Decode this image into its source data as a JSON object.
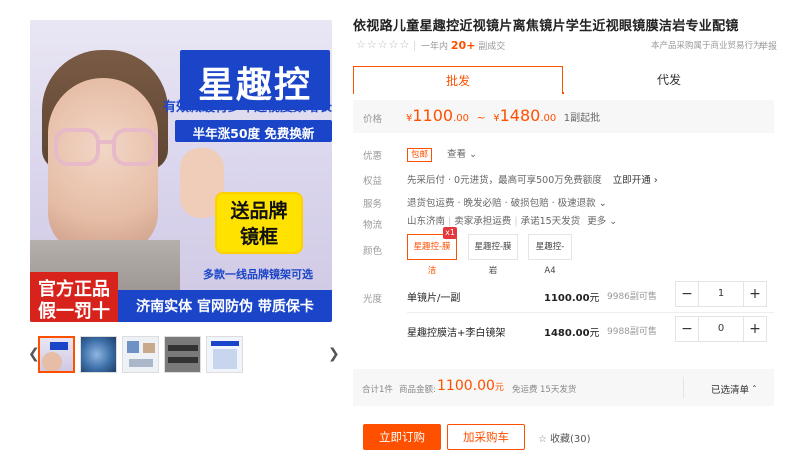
{
  "gallery": {
    "main_image": {
      "title": "星趣控",
      "subtitle1": "有效减缓青少年近视度数增长",
      "subtitle2": "半年涨50度  免费换新",
      "gift_line1": "送品牌",
      "gift_line2": "镜框",
      "multi_brand": "多款一线品牌镜架可选",
      "badge_line1": "官方正品",
      "badge_line2": "假一罚十",
      "bottom_bar": "济南实体  官网防伪  带质保卡"
    },
    "thumbnails": [
      {
        "name": "thumb-1",
        "color": "#d9d4ec",
        "active": true
      },
      {
        "name": "thumb-2",
        "color": "#5a8fc7",
        "active": false
      },
      {
        "name": "thumb-3",
        "color": "#cfd8e3",
        "active": false
      },
      {
        "name": "thumb-4",
        "color": "#6c6c6c",
        "active": false
      },
      {
        "name": "thumb-5",
        "color": "#dfe7f4",
        "active": false
      }
    ],
    "prev_icon": "chevron-left-icon",
    "next_icon": "chevron-right-icon"
  },
  "product": {
    "title": "依视路儿童星趣控近视镜片离焦镜片学生近视眼镜膜洁岩专业配镜",
    "rating_stars": "☆☆☆☆☆",
    "sold_prefix": "一年内",
    "sold_count": "20+",
    "sold_suffix": "副成交",
    "notice": "本产品采购属于商业贸易行为",
    "report": "举报"
  },
  "tabs": {
    "wholesale": "批发",
    "dropship": "代发"
  },
  "price": {
    "label": "价格",
    "currency": "¥",
    "low_int": "1100",
    "low_dec": ".00",
    "tilde": "~",
    "high_int": "1480",
    "high_dec": ".00",
    "moq": "1副起批"
  },
  "offers": {
    "label": "优惠",
    "tag": "包邮",
    "view": "查看",
    "view_icon": "chevron-down-icon"
  },
  "rights": {
    "label": "权益",
    "text": "先采后付 · 0元进货，最高可享500万免费额度",
    "link": "立即开通",
    "link_icon": "chevron-right-icon"
  },
  "service": {
    "label": "服务",
    "text": "退货包运费 · 晚发必赔 · 破损包赔 · 极速退款",
    "icon": "chevron-down-icon"
  },
  "logistics": {
    "label": "物流",
    "location": "山东济南",
    "carrier": "卖家承担运费",
    "commit": "承诺15天发货",
    "more": "更多",
    "icon": "chevron-down-icon"
  },
  "color": {
    "label": "颜色",
    "options": [
      "星趣控-膜洁",
      "星趣控-膜岩",
      "星趣控-A4"
    ],
    "selected_badge": "x1"
  },
  "specs": {
    "label": "光度",
    "rows": [
      {
        "name": "单镜片/一副",
        "price": "1100.00",
        "unit": "元",
        "stock": "9986副可售",
        "qty": "1"
      },
      {
        "name": "星趣控膜洁+李白镜架",
        "price": "1480.00",
        "unit": "元",
        "stock": "9988副可售",
        "qty": "0"
      }
    ]
  },
  "summary": {
    "count": "合计1件",
    "amount_label": "商品金额:",
    "amount": "1100.00",
    "amount_unit": "元",
    "ship_label": "免运费",
    "ship_days": "15天发货",
    "selected": "已选清单",
    "selected_icon": "chevron-up-icon"
  },
  "actions": {
    "order": "立即订购",
    "cart": "加采购车",
    "favorite": "收藏(30)"
  },
  "colors": {
    "accent": "#ff5000",
    "brand_blue": "#1b45c9",
    "badge_red": "#d7231c",
    "gift_yellow": "#ffe200"
  }
}
